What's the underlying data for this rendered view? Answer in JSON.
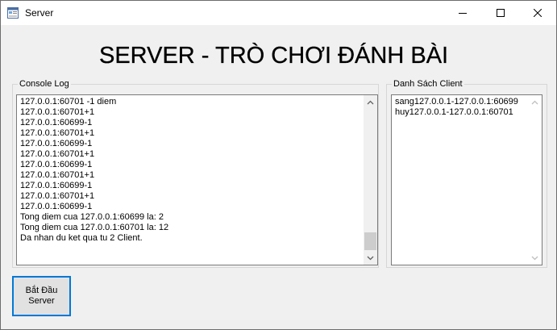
{
  "window": {
    "title": "Server",
    "icon": "app-form-icon",
    "controls": [
      "minimize-icon",
      "maximize-icon",
      "close-icon"
    ]
  },
  "heading": "SERVER - TRÒ CHƠI ĐÁNH BÀI",
  "console": {
    "group_label": "Console Log",
    "lines": [
      "127.0.0.1:60701 -1 diem",
      "127.0.0.1:60701+1",
      "127.0.0.1:60699-1",
      "127.0.0.1:60701+1",
      "127.0.0.1:60699-1",
      "127.0.0.1:60701+1",
      "127.0.0.1:60699-1",
      "127.0.0.1:60701+1",
      "127.0.0.1:60699-1",
      "127.0.0.1:60701+1",
      "127.0.0.1:60699-1",
      "Tong diem cua 127.0.0.1:60699 la: 2",
      "Tong diem cua 127.0.0.1:60701 la: 12",
      "Da nhan du ket qua tu 2 Client."
    ]
  },
  "clients": {
    "group_label": "Danh Sách Client",
    "items": [
      "sang127.0.0.1-127.0.0.1:60699",
      "huy127.0.0.1-127.0.0.1:60701"
    ]
  },
  "start_button": {
    "line1": "Bắt Đầu",
    "line2": "Server"
  },
  "colors": {
    "window_bg": "#f0f0f0",
    "titlebar_bg": "#ffffff",
    "button_focus_border": "#0078d7",
    "button_bg": "#e1e1e1",
    "scroll_thumb": "#cdcdcd"
  }
}
